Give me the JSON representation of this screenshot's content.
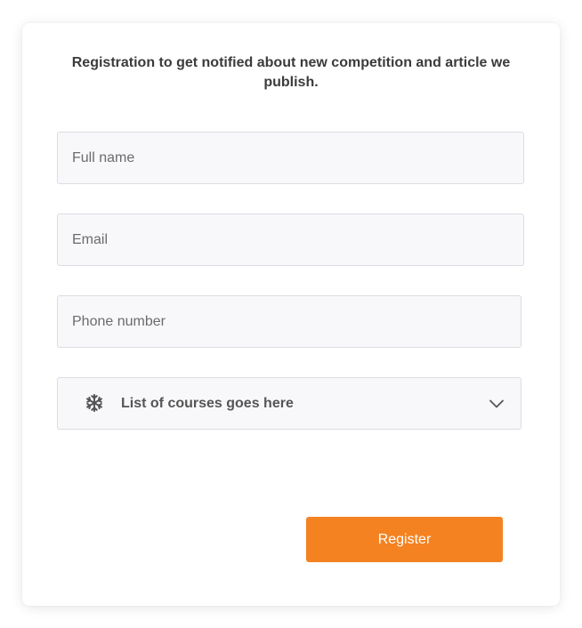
{
  "form": {
    "headline": "Registration to get notified about new competition and article we publish.",
    "full_name": {
      "placeholder": "Full name",
      "value": ""
    },
    "email": {
      "placeholder": "Email",
      "value": ""
    },
    "phone": {
      "placeholder": "Phone number",
      "value": ""
    },
    "courses_select": {
      "selected_label": "List of courses goes here",
      "icon": "snowflake-icon",
      "indicator_icon": "chevron-down-icon"
    },
    "register_label": "Register"
  },
  "colors": {
    "accent": "#f58220",
    "field_bg": "#f8f8fb",
    "field_border": "#dcdce2",
    "text": "#3b3b3b"
  }
}
